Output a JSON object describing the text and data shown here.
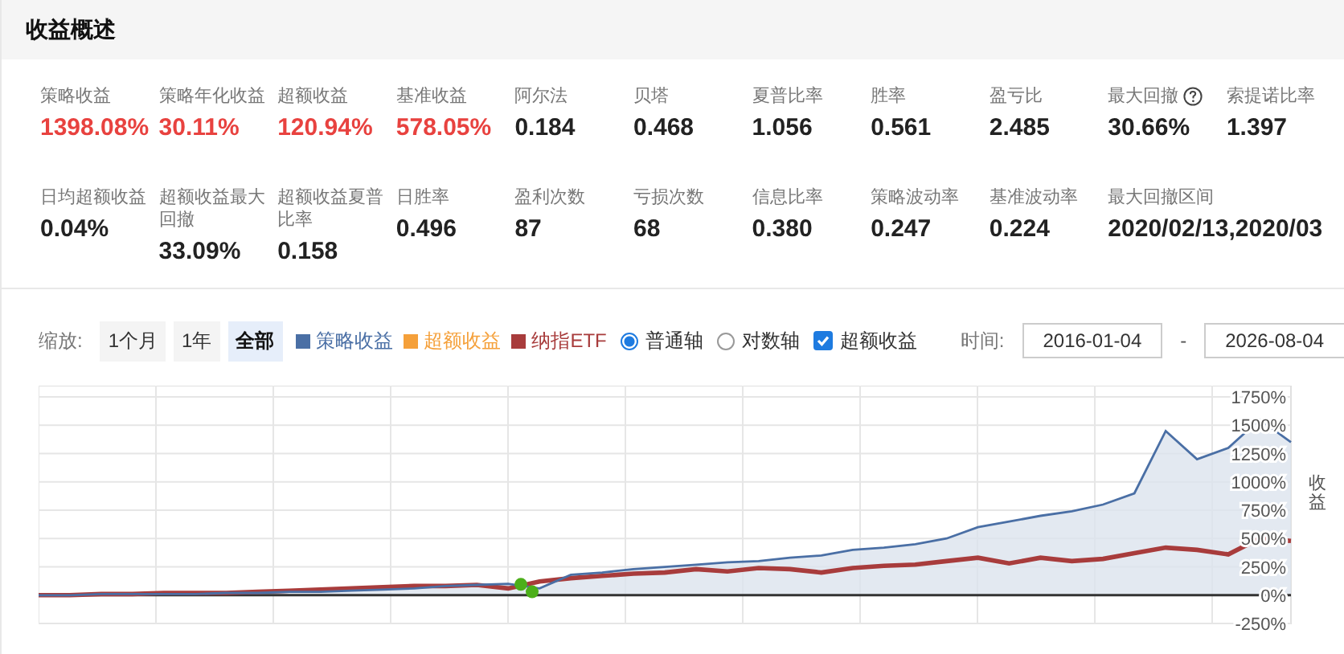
{
  "panel": {
    "title": "收益概述"
  },
  "metrics": [
    {
      "label": "策略收益",
      "value": "1398.08%",
      "color": "#e8423f",
      "help": false
    },
    {
      "label": "策略年化收益",
      "value": "30.11%",
      "color": "#e8423f",
      "help": false
    },
    {
      "label": "超额收益",
      "value": "120.94%",
      "color": "#e8423f",
      "help": false
    },
    {
      "label": "基准收益",
      "value": "578.05%",
      "color": "#e8423f",
      "help": false
    },
    {
      "label": "阿尔法",
      "value": "0.184",
      "color": "#222222",
      "help": false
    },
    {
      "label": "贝塔",
      "value": "0.468",
      "color": "#222222",
      "help": false
    },
    {
      "label": "夏普比率",
      "value": "1.056",
      "color": "#222222",
      "help": false
    },
    {
      "label": "胜率",
      "value": "0.561",
      "color": "#222222",
      "help": false
    },
    {
      "label": "盈亏比",
      "value": "2.485",
      "color": "#222222",
      "help": false
    },
    {
      "label": "最大回撤",
      "value": "30.66%",
      "color": "#222222",
      "help": true
    },
    {
      "label": "索提诺比率",
      "value": "1.397",
      "color": "#222222",
      "help": false
    },
    {
      "label": "日均超额收益",
      "value": "0.04%",
      "color": "#222222",
      "help": false
    },
    {
      "label": "超额收益最大回撤",
      "value": "33.09%",
      "color": "#222222",
      "help": false
    },
    {
      "label": "超额收益夏普比率",
      "value": "0.158",
      "color": "#222222",
      "help": false
    },
    {
      "label": "日胜率",
      "value": "0.496",
      "color": "#222222",
      "help": false
    },
    {
      "label": "盈利次数",
      "value": "87",
      "color": "#222222",
      "help": false
    },
    {
      "label": "亏损次数",
      "value": "68",
      "color": "#222222",
      "help": false
    },
    {
      "label": "信息比率",
      "value": "0.380",
      "color": "#222222",
      "help": false
    },
    {
      "label": "策略波动率",
      "value": "0.247",
      "color": "#222222",
      "help": false
    },
    {
      "label": "基准波动率",
      "value": "0.224",
      "color": "#222222",
      "help": false
    },
    {
      "label": "最大回撤区间",
      "value": "2020/02/13,2020/03",
      "color": "#222222",
      "help": false
    }
  ],
  "toolbar": {
    "zoom_label": "缩放:",
    "zoom_buttons": [
      {
        "label": "1个月",
        "selected": false
      },
      {
        "label": "1年",
        "selected": false
      },
      {
        "label": "全部",
        "selected": true
      }
    ],
    "legend": [
      {
        "label": "超额收益",
        "color": "#f5a03a"
      }
    ],
    "axis_modes": [
      {
        "label": "普通轴",
        "selected": true
      },
      {
        "label": "对数轴",
        "selected": false
      }
    ],
    "excess_toggle": {
      "label": "超额收益",
      "checked": true
    },
    "time_label": "时间:",
    "date_from": "2016-01-04",
    "date_separator": "-",
    "date_to": "2026-08-04"
  },
  "chart": {
    "chart_data": {
      "type": "line",
      "ylabel": "收益",
      "ylim": [
        -250,
        1850
      ],
      "grid": true,
      "yticks": [
        {
          "value": -250,
          "label": "-250%"
        },
        {
          "value": 0,
          "label": "0%"
        },
        {
          "value": 250,
          "label": "250%"
        },
        {
          "value": 500,
          "label": "500%"
        },
        {
          "value": 750,
          "label": "750%"
        },
        {
          "value": 1000,
          "label": "1000%"
        },
        {
          "value": 1250,
          "label": "1250%"
        },
        {
          "value": 1500,
          "label": "1500%"
        },
        {
          "value": 1750,
          "label": "1750%"
        }
      ],
      "series": [
        {
          "name": "策略收益",
          "color": "#4a6fa5",
          "values": [
            0,
            0,
            10,
            10,
            10,
            10,
            20,
            20,
            30,
            30,
            40,
            50,
            60,
            80,
            90,
            100,
            60,
            180,
            200,
            230,
            250,
            270,
            290,
            300,
            330,
            350,
            400,
            420,
            450,
            500,
            600,
            650,
            700,
            740,
            800,
            900,
            1450,
            1200,
            1300,
            1550,
            1350
          ]
        },
        {
          "name": "纳指ETF",
          "color": "#a83c3c",
          "values": [
            0,
            0,
            10,
            10,
            20,
            20,
            20,
            30,
            40,
            50,
            60,
            70,
            80,
            80,
            90,
            60,
            120,
            150,
            170,
            190,
            200,
            230,
            210,
            240,
            230,
            200,
            240,
            260,
            270,
            300,
            330,
            280,
            330,
            300,
            320,
            370,
            420,
            400,
            360,
            500,
            480
          ]
        }
      ]
    }
  }
}
